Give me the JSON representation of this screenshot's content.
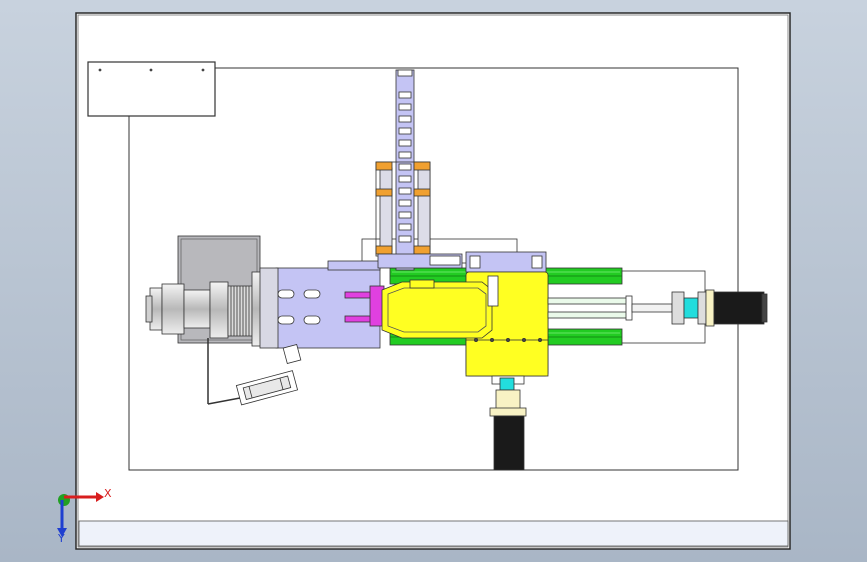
{
  "viewport": {
    "background_top": "#c5cfdb",
    "background_bottom": "#aab7c6"
  },
  "sheet": {
    "paper_color": "#ffffff",
    "border_color": "#333333",
    "title_block_color": "#eef2fa"
  },
  "triad": {
    "x_label": "X",
    "y_label": "Y",
    "x_color": "#d81e1e",
    "y_color": "#1f3fd0",
    "z_color": "#22a022"
  },
  "colors": {
    "lavender": "#c4c4f4",
    "yellow": "#ffff22",
    "green": "#22cc22",
    "magenta": "#e040e0",
    "cyan": "#22dddd",
    "orange": "#f0a030",
    "gray_plate": "#b8b8bc",
    "motor_black": "#1a1a1a",
    "motor_flange": "#f8f2c4"
  }
}
